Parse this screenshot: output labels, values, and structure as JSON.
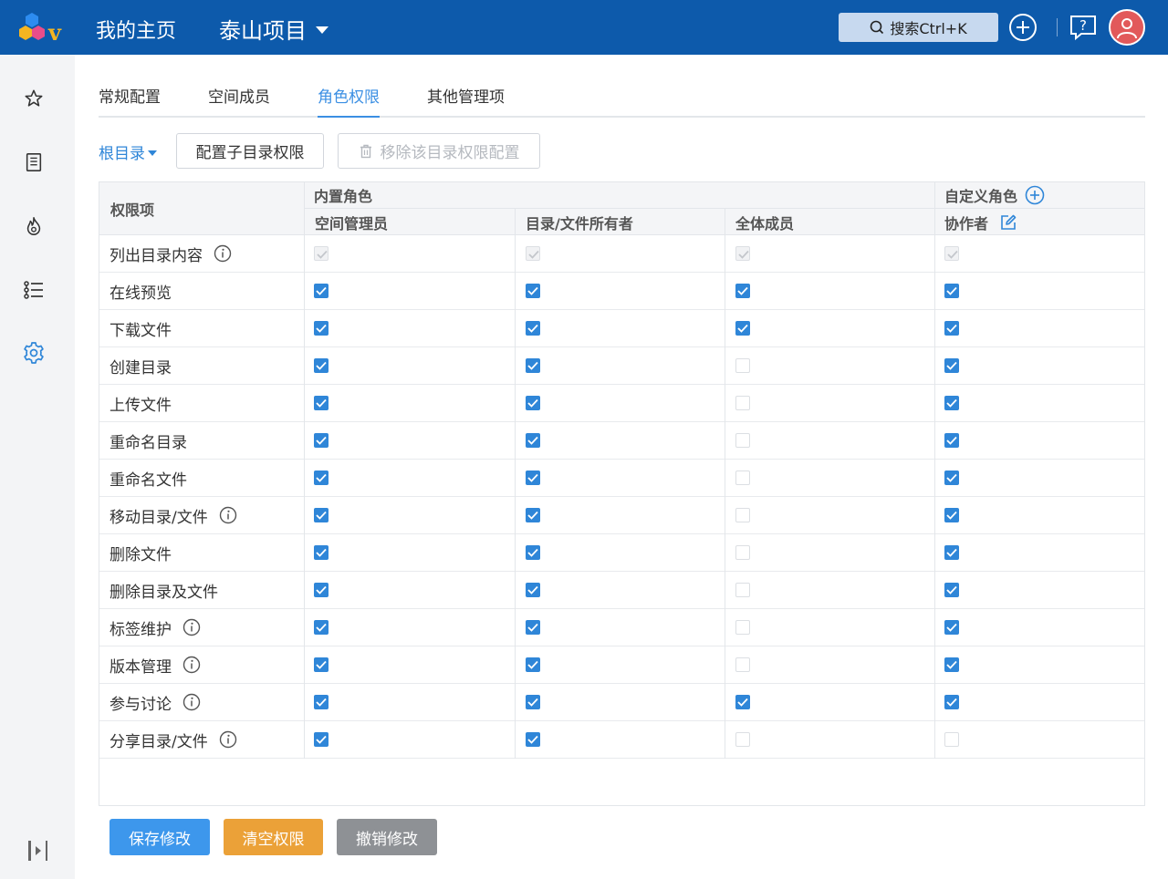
{
  "header": {
    "home_label": "我的主页",
    "project_label": "泰山项目",
    "search_label": "搜索Ctrl+K"
  },
  "tabs": [
    {
      "label": "常规配置",
      "active": false
    },
    {
      "label": "空间成员",
      "active": false
    },
    {
      "label": "角色权限",
      "active": true
    },
    {
      "label": "其他管理项",
      "active": false
    }
  ],
  "toolbar": {
    "directory": "根目录",
    "config_sub_label": "配置子目录权限",
    "remove_label": "移除该目录权限配置"
  },
  "table": {
    "col_permission": "权限项",
    "group_builtin": "内置角色",
    "group_custom": "自定义角色",
    "roles": [
      "空间管理员",
      "目录/文件所有者",
      "全体成员",
      "协作者"
    ],
    "rows": [
      {
        "label": "列出目录内容",
        "info": true,
        "values": [
          "disabled",
          "disabled",
          "disabled",
          "disabled"
        ]
      },
      {
        "label": "在线预览",
        "info": false,
        "values": [
          "on",
          "on",
          "on",
          "on"
        ]
      },
      {
        "label": "下载文件",
        "info": false,
        "values": [
          "on",
          "on",
          "on",
          "on"
        ]
      },
      {
        "label": "创建目录",
        "info": false,
        "values": [
          "on",
          "on",
          "off",
          "on"
        ]
      },
      {
        "label": "上传文件",
        "info": false,
        "values": [
          "on",
          "on",
          "off",
          "on"
        ]
      },
      {
        "label": "重命名目录",
        "info": false,
        "values": [
          "on",
          "on",
          "off",
          "on"
        ]
      },
      {
        "label": "重命名文件",
        "info": false,
        "values": [
          "on",
          "on",
          "off",
          "on"
        ]
      },
      {
        "label": "移动目录/文件",
        "info": true,
        "values": [
          "on",
          "on",
          "off",
          "on"
        ]
      },
      {
        "label": "删除文件",
        "info": false,
        "values": [
          "on",
          "on",
          "off",
          "on"
        ]
      },
      {
        "label": "删除目录及文件",
        "info": false,
        "values": [
          "on",
          "on",
          "off",
          "on"
        ]
      },
      {
        "label": "标签维护",
        "info": true,
        "values": [
          "on",
          "on",
          "off",
          "on"
        ]
      },
      {
        "label": "版本管理",
        "info": true,
        "values": [
          "on",
          "on",
          "off",
          "on"
        ]
      },
      {
        "label": "参与讨论",
        "info": true,
        "values": [
          "on",
          "on",
          "on",
          "on"
        ]
      },
      {
        "label": "分享目录/文件",
        "info": true,
        "values": [
          "on",
          "on",
          "off",
          "off"
        ]
      }
    ]
  },
  "footer": {
    "save_label": "保存修改",
    "clear_label": "清空权限",
    "cancel_label": "撤销修改"
  },
  "colors": {
    "topbar": "#0d5aab",
    "accent": "#2f86d8",
    "save": "#3d97ec",
    "clear": "#eba138",
    "cancel": "#8e9195"
  }
}
